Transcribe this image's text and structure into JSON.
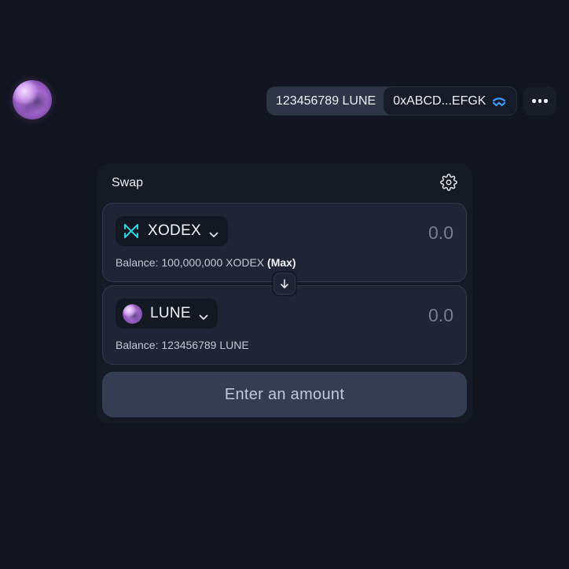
{
  "header": {
    "logo_icon": "moon-logo-icon",
    "account": {
      "balance": "123456789 LUNE",
      "address": "0xABCD...EFGK",
      "wallet_icon": "walletconnect-icon"
    },
    "more_icon": "more-dots-icon"
  },
  "swap": {
    "title": "Swap",
    "settings_icon": "gear-icon",
    "from": {
      "token": "XODEX",
      "token_icon": "xodex-icon",
      "amount_placeholder": "0.0",
      "balance_text": "Balance: 100,000,000 XODEX",
      "max_label": "(Max)"
    },
    "flip_icon": "arrow-down-icon",
    "to": {
      "token": "LUNE",
      "token_icon": "lune-icon",
      "amount_placeholder": "0.0",
      "balance_text": "Balance: 123456789 LUNE"
    },
    "submit_label": "Enter an amount"
  },
  "colors": {
    "background": "#121420",
    "card": "#161a24",
    "panel": "#1f2534",
    "button": "#343d52",
    "xodex_accent": "#2fd2d8",
    "walletconnect_accent": "#3b99fc"
  }
}
